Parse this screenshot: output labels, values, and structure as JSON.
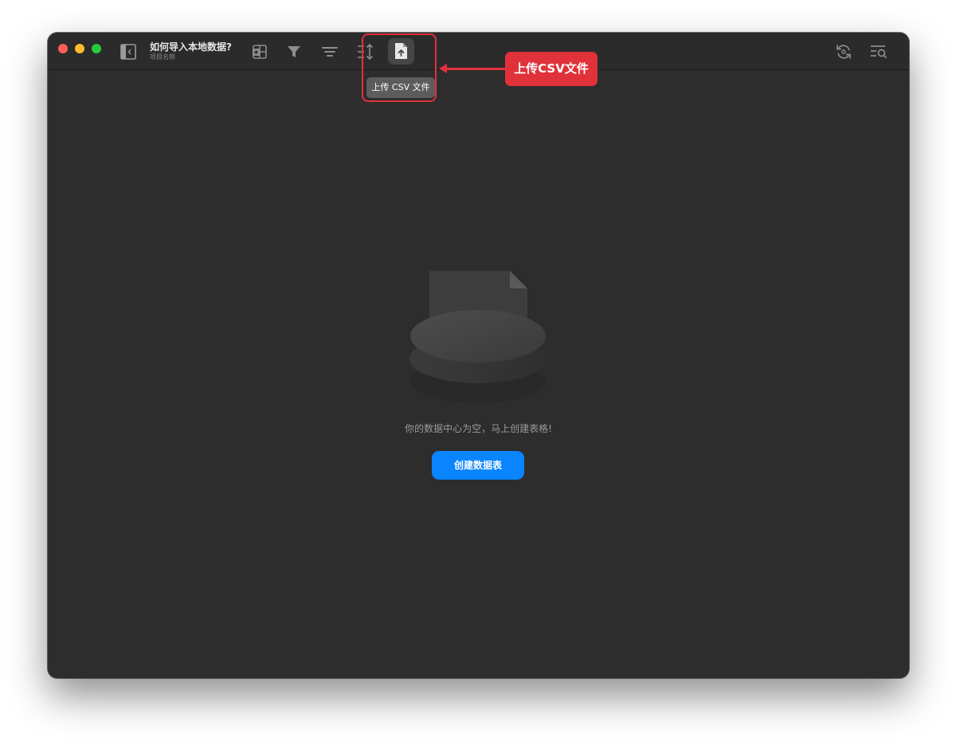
{
  "window": {
    "title": "如何导入本地数据?",
    "subtitle": "项目名称"
  },
  "toolbar": {
    "icons": [
      "sidebar-toggle-icon",
      "add-table-icon",
      "filter-icon",
      "sort-icon",
      "row-height-icon",
      "upload-csv-icon",
      "sync-icon",
      "search-list-icon"
    ],
    "upload_tooltip": "上传 CSV 文件"
  },
  "annotation": {
    "callout_label": "上传CSV文件",
    "color": "#e0323b"
  },
  "empty_state": {
    "message": "你的数据中心为空，马上创建表格!",
    "button_label": "创建数据表",
    "button_color": "#0a84ff"
  }
}
